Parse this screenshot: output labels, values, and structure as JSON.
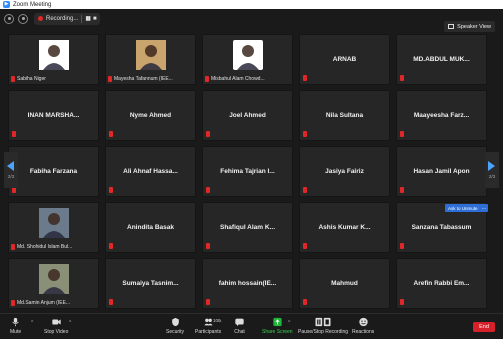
{
  "window": {
    "title": "Zoom Meeting"
  },
  "topbar": {
    "recording_label": "Recording...",
    "view_label": "Speaker View"
  },
  "pager": {
    "left": "2/3",
    "right": "2/3"
  },
  "ask_unmute": "Ask to Unmute",
  "more_label": "...",
  "tiles": [
    {
      "name": "Sabiha Niger",
      "kind": "video"
    },
    {
      "name": "Mayesha Tafannum (IEE...",
      "kind": "video"
    },
    {
      "name": "Misbahul Alam Chowd...",
      "kind": "video"
    },
    {
      "name": "ARNAB",
      "kind": "name"
    },
    {
      "name": "MD.ABDUL MUK...",
      "kind": "name"
    },
    {
      "name": "INAN MARSHA...",
      "kind": "name"
    },
    {
      "name": "Nyme Ahmed",
      "kind": "name"
    },
    {
      "name": "Joel Ahmed",
      "kind": "name"
    },
    {
      "name": "Nila Sultana",
      "kind": "name"
    },
    {
      "name": "Maayeesha Farz...",
      "kind": "name"
    },
    {
      "name": "Fabiha Farzana",
      "kind": "name"
    },
    {
      "name": "Ali Ahnaf Hassa...",
      "kind": "name"
    },
    {
      "name": "Fehima Tajrian I...",
      "kind": "name"
    },
    {
      "name": "Jasiya Fairiz",
      "kind": "name"
    },
    {
      "name": "Hasan Jamil Apon",
      "kind": "name"
    },
    {
      "name": "Md. Shohidul Islam Bul...",
      "kind": "video"
    },
    {
      "name": "Anindita Basak",
      "kind": "name"
    },
    {
      "name": "Shafiqul Alam K...",
      "kind": "name"
    },
    {
      "name": "Ashis Kumar K...",
      "kind": "name"
    },
    {
      "name": "Sanzana Tabassum",
      "kind": "name"
    },
    {
      "name": "Md.Samin Anjum (IEE...",
      "kind": "video"
    },
    {
      "name": "Sumaiya Tasnim...",
      "kind": "name"
    },
    {
      "name": "fahim hossain(IE...",
      "kind": "name"
    },
    {
      "name": "Mahmud",
      "kind": "name"
    },
    {
      "name": "Arefin Rabbi Em...",
      "kind": "name"
    }
  ],
  "toolbar": {
    "mute": "Mute",
    "stop_video": "Stop Video",
    "security": "Security",
    "participants": "Participants",
    "participants_count": "100",
    "chat": "Chat",
    "share": "Share Screen",
    "record": "Pause/Stop Recording",
    "reactions": "Reactions",
    "end": "End"
  },
  "colors": {
    "end": "#d6202a",
    "share": "#22b33a",
    "accent": "#2d8cff",
    "mic_muted": "#e02828"
  }
}
